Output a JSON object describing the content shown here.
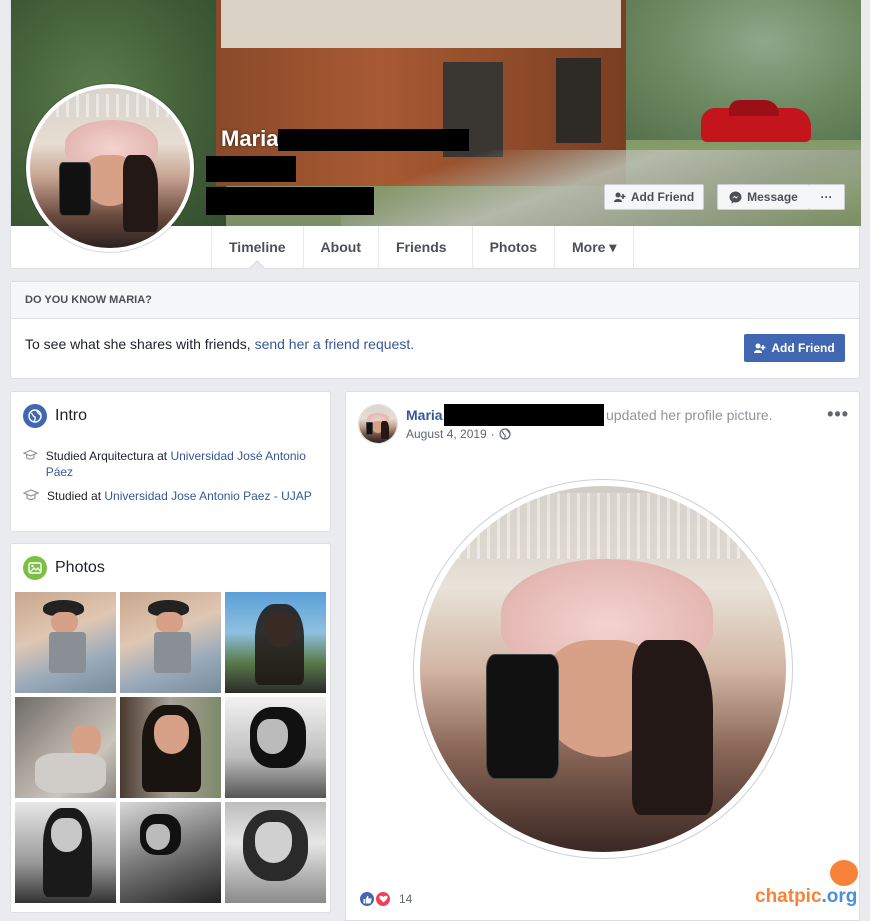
{
  "profile": {
    "name": "Maria",
    "buttons": {
      "add_friend": "Add Friend",
      "message": "Message",
      "more": "···"
    }
  },
  "tabs": [
    {
      "label": "Timeline",
      "active": true
    },
    {
      "label": "About"
    },
    {
      "label": "Friends"
    },
    {
      "label": "Photos"
    },
    {
      "label": "More ▾"
    }
  ],
  "know": {
    "heading": "DO YOU KNOW MARIA?",
    "text": "To see what she shares with friends, ",
    "link": "send her a friend request.",
    "button": "Add Friend"
  },
  "intro": {
    "title": "Intro",
    "items": [
      {
        "prefix": "Studied Arquitectura at ",
        "link": "Universidad José Antonio Páez"
      },
      {
        "prefix": "Studied at ",
        "link": "Universidad Jose Antonio Paez - UJAP"
      }
    ]
  },
  "photos": {
    "title": "Photos"
  },
  "post": {
    "author": "Maria",
    "action": "updated her profile picture.",
    "date": "August 4, 2019",
    "separator": "·",
    "more": "•••",
    "reaction_count": "14"
  },
  "watermark": {
    "text_a": "chatpic",
    "text_b": ".org"
  },
  "colors": {
    "brand_blue": "#4267b2",
    "link_blue": "#365899",
    "page_bg": "#e9ebee"
  }
}
